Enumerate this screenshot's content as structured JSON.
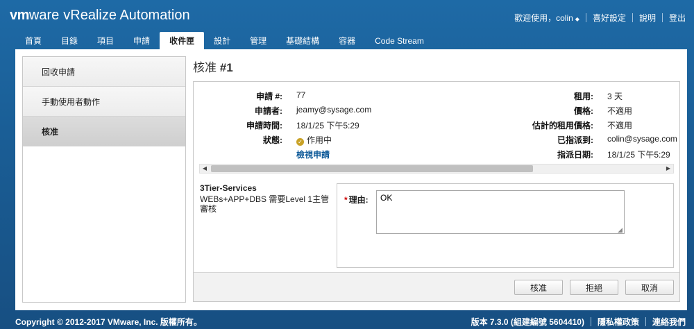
{
  "header": {
    "logo_vm": "vm",
    "logo_ware": "ware",
    "product": "vRealize Automation",
    "welcome": "歡迎使用，colin",
    "preferences": "喜好設定",
    "help": "說明",
    "logout": "登出"
  },
  "nav": {
    "tabs": [
      "首頁",
      "目錄",
      "項目",
      "申請",
      "收件匣",
      "設計",
      "管理",
      "基礎結構",
      "容器",
      "Code Stream"
    ],
    "active": "收件匣"
  },
  "sidebar": {
    "items": [
      "回收申請",
      "手動使用者動作",
      "核准"
    ],
    "active": "核准"
  },
  "page": {
    "title_prefix": "核准",
    "title_num": "#1"
  },
  "details": {
    "request_no_label": "申請 #:",
    "request_no": "77",
    "requester_label": "申請者:",
    "requester": "jeamy@sysage.com",
    "request_time_label": "申請時間:",
    "request_time": "18/1/25 下午5:29",
    "status_label": "狀態:",
    "status": "作用中",
    "view_request_link": "檢視申請",
    "lease_label": "租用:",
    "lease": "3 天",
    "price_label": "價格:",
    "price": "不適用",
    "est_price_label": "估計的租用價格:",
    "est_price": "不適用",
    "assigned_to_label": "已指派到:",
    "assigned_to": "colin@sysage.com",
    "assigned_date_label": "指派日期:",
    "assigned_date": "18/1/25 下午5:29"
  },
  "service": {
    "name": "3Tier-Services",
    "description": "WEBs+APP+DBS 需要Level 1主管審核"
  },
  "reason": {
    "required_mark": "*",
    "label": "理由:",
    "value": "OK"
  },
  "buttons": {
    "approve": "核准",
    "reject": "拒絕",
    "cancel": "取消"
  },
  "footer": {
    "copyright": "Copyright © 2012-2017 VMware, Inc. 版權所有。",
    "version": "版本 7.3.0 (組建編號 5604410)",
    "privacy": "隱私權政策",
    "contact": "連絡我們"
  },
  "icons": {
    "status": "check-circle-icon",
    "welcome_menu": "chevron-down-icon",
    "scroll_left": "arrow-left-icon",
    "scroll_right": "arrow-right-icon",
    "resize": "resize-grip-icon"
  },
  "colors": {
    "header_bg": "#1a5e96",
    "link": "#0a5797",
    "status_icon": "#c9a227",
    "required": "#cc0000"
  }
}
